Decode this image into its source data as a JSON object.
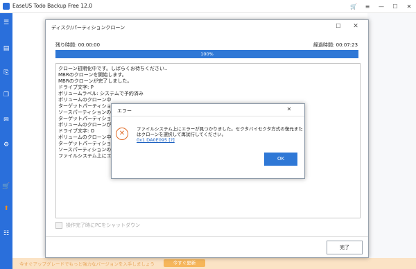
{
  "app": {
    "title": "EaseUS Todo Backup Free 12.0"
  },
  "promo": {
    "text": "今すぐアップグレードでもっと強力なバージョンを入手しましょう",
    "button": "今すぐ更新"
  },
  "dialog": {
    "title": "ディスク/パーティションクローン",
    "remaining_label": "残り時間:  00:00:00",
    "elapsed_label": "経過時間:  00:07:23",
    "progress_text": "100%",
    "progress_fraction": 1.0,
    "log": [
      "クローン初期化中です。しばらくお待ちください..",
      "MBRのクローンを開始します。",
      "MBRのクローンが完了しました。",
      "ドライブ文字: P",
      "ボリュームラベル: システムで予約済み",
      "ボリュームのクローン中",
      "ターゲットパーティションのチェック中",
      "ソースパーティションのコピ",
      "ターゲットパーティションにコ",
      "ボリュームのクローンが完了し",
      "ドライブ文字: O",
      "ボリュームのクローン中",
      "ターゲットパーティションのチ",
      "ソースパーティションのコピ",
      "ファイルシステム上にエラー"
    ],
    "shutdown_label": "操作完了時にPCをシャットダウン",
    "done_button": "完了"
  },
  "error": {
    "title": "エラー",
    "message": "ファイルシステム上にエラーが見つかりました。セクタバイセクタ方式の復元またはクローンを選択して再試行してください。",
    "code": "0x1 DA0E095 [?]",
    "ok_button": "OK"
  },
  "colors": {
    "accent": "#2f78d6",
    "sidebar": "#2a6fdb",
    "error": "#e06a24"
  },
  "icons": [
    "app-logo-icon",
    "cart-icon",
    "settings-icon",
    "minimize-icon",
    "maximize-icon",
    "close-icon",
    "menu-icon",
    "backup-icon",
    "restore-icon",
    "clone-icon",
    "mail-icon",
    "tools-icon",
    "cart-icon",
    "logs-icon",
    "error-icon"
  ]
}
